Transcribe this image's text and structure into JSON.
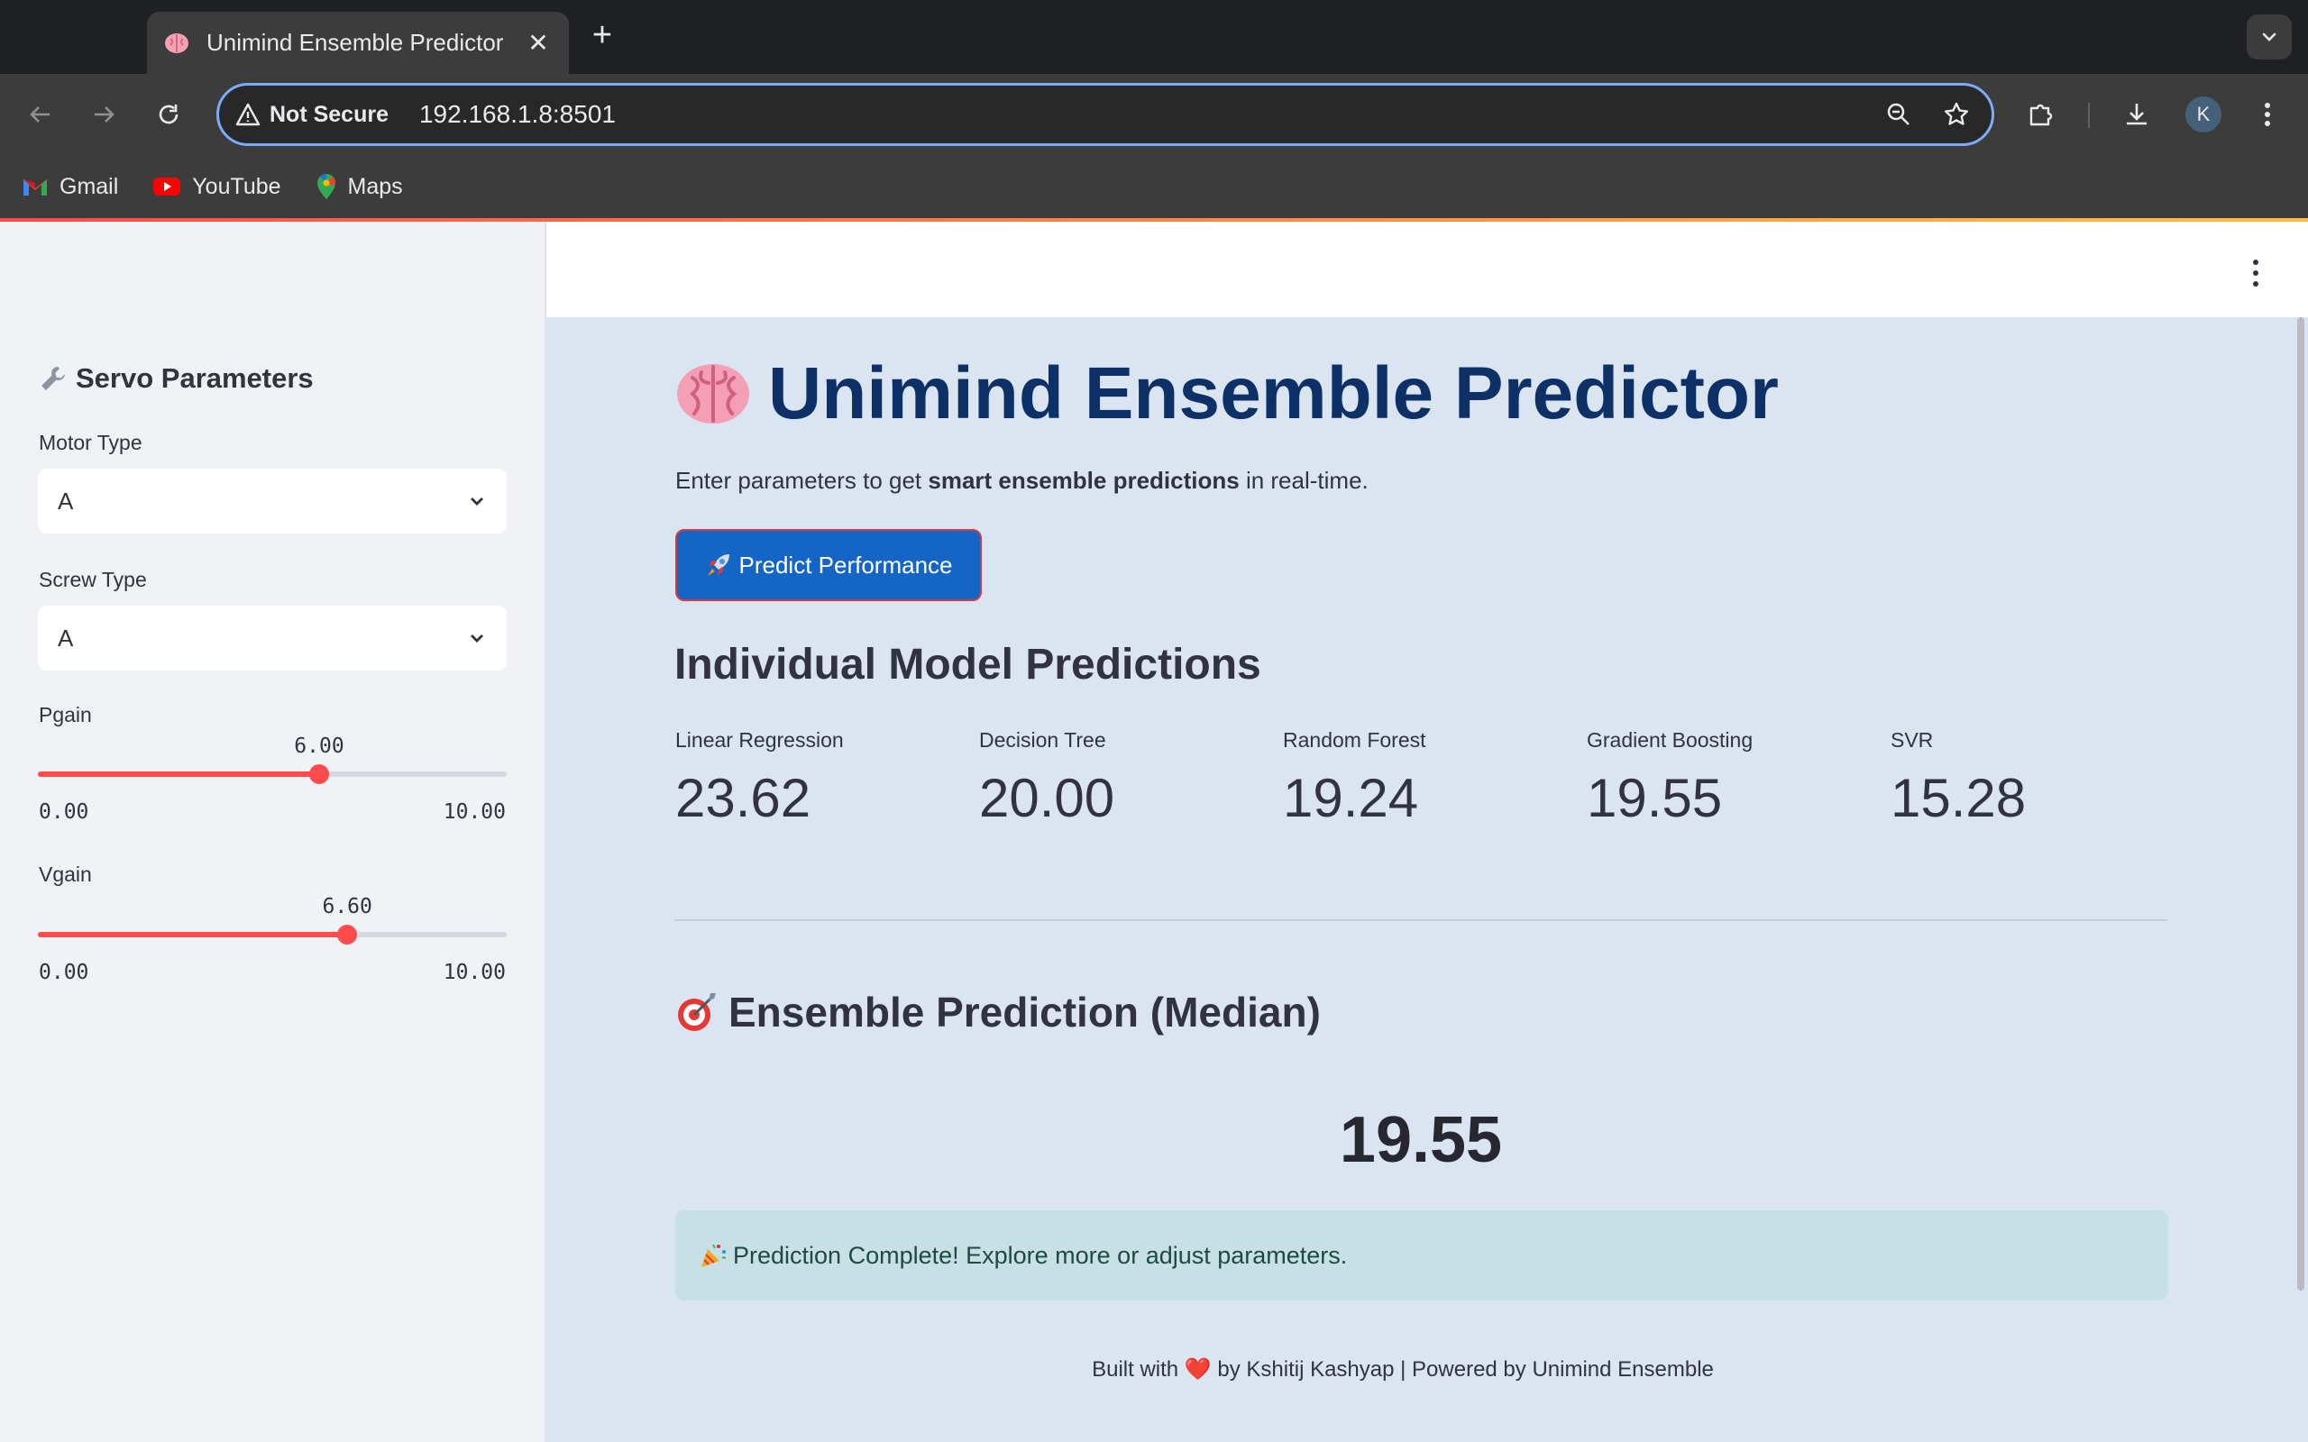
{
  "browser": {
    "tab_title": "Unimind Ensemble Predictor",
    "tab_close": "✕",
    "new_tab": "+",
    "security_label": "Not Secure",
    "url": "192.168.1.8:8501",
    "profile_initial": "K",
    "bookmarks": [
      {
        "label": "Gmail",
        "icon": "gmail-icon"
      },
      {
        "label": "YouTube",
        "icon": "youtube-icon"
      },
      {
        "label": "Maps",
        "icon": "maps-icon"
      }
    ]
  },
  "sidebar": {
    "heading": "Servo Parameters",
    "heading_icon": "wrench-icon",
    "motor_type": {
      "label": "Motor Type",
      "value": "A"
    },
    "screw_type": {
      "label": "Screw Type",
      "value": "A"
    },
    "pgain": {
      "label": "Pgain",
      "value": "6.00",
      "min": "0.00",
      "max": "10.00",
      "level": 0.6
    },
    "vgain": {
      "label": "Vgain",
      "value": "6.60",
      "min": "0.00",
      "max": "10.00",
      "level": 0.66
    }
  },
  "main": {
    "title": "Unimind Ensemble Predictor",
    "title_icon": "brain-icon",
    "intro_before": "Enter parameters to get ",
    "intro_bold": "smart ensemble predictions",
    "intro_after": " in real-time.",
    "predict_button": "Predict Performance",
    "predict_icon": "rocket-icon",
    "section_title": "Individual Model Predictions",
    "metrics": [
      {
        "label": "Linear Regression",
        "value": "23.62"
      },
      {
        "label": "Decision Tree",
        "value": "20.00"
      },
      {
        "label": "Random Forest",
        "value": "19.24"
      },
      {
        "label": "Gradient Boosting",
        "value": "19.55"
      },
      {
        "label": "SVR",
        "value": "15.28"
      }
    ],
    "ensemble_title": "Ensemble Prediction (Median)",
    "ensemble_icon": "target-icon",
    "ensemble_value": "19.55",
    "success_message": "Prediction Complete! Explore more or adjust parameters.",
    "success_icon": "party-popper-icon",
    "footer_before": "Built with ",
    "footer_heart": "❤️",
    "footer_after": " by Kshitij Kashyap | Powered by Unimind Ensemble"
  },
  "colors": {
    "accent": "#ff4b4b",
    "title": "#0d3166",
    "button": "#1565c7",
    "main_bg": "#dbe5f2",
    "sidebar_bg": "#f0f2f6",
    "success_bg": "#c6e0e6"
  }
}
